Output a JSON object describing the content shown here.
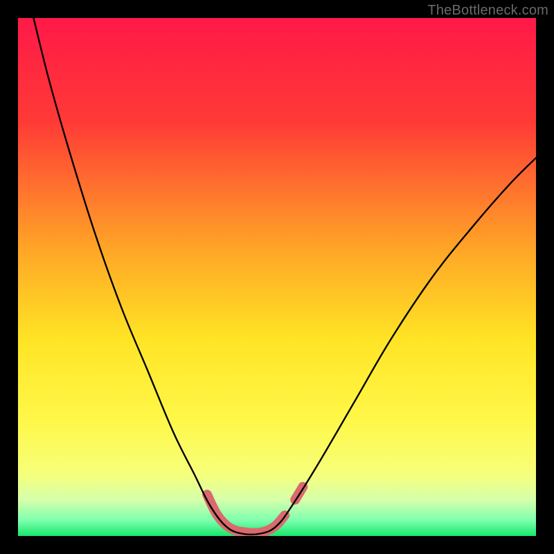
{
  "watermark": "TheBottleneck.com",
  "chart_data": {
    "type": "line",
    "title": "",
    "xlabel": "",
    "ylabel": "",
    "xlim": [
      0,
      100
    ],
    "ylim": [
      0,
      100
    ],
    "gradient_stops": [
      {
        "offset": 0,
        "color": "#ff1948"
      },
      {
        "offset": 20,
        "color": "#ff3a36"
      },
      {
        "offset": 45,
        "color": "#ffa726"
      },
      {
        "offset": 62,
        "color": "#ffe425"
      },
      {
        "offset": 78,
        "color": "#fff84a"
      },
      {
        "offset": 88,
        "color": "#f6ff7a"
      },
      {
        "offset": 93,
        "color": "#d6ffab"
      },
      {
        "offset": 97,
        "color": "#7dffad"
      },
      {
        "offset": 100,
        "color": "#16e76b"
      }
    ],
    "series": [
      {
        "name": "bottleneck-curve",
        "stroke": "#000000",
        "stroke_width": 2.4,
        "points": [
          {
            "x": 3,
            "y": 100
          },
          {
            "x": 6,
            "y": 88
          },
          {
            "x": 10,
            "y": 74
          },
          {
            "x": 15,
            "y": 58
          },
          {
            "x": 20,
            "y": 44
          },
          {
            "x": 25,
            "y": 32
          },
          {
            "x": 30,
            "y": 20
          },
          {
            "x": 34,
            "y": 12
          },
          {
            "x": 37,
            "y": 6
          },
          {
            "x": 40,
            "y": 2
          },
          {
            "x": 43,
            "y": 0.5
          },
          {
            "x": 47,
            "y": 0.5
          },
          {
            "x": 50,
            "y": 2
          },
          {
            "x": 53,
            "y": 6
          },
          {
            "x": 58,
            "y": 14
          },
          {
            "x": 65,
            "y": 26
          },
          {
            "x": 72,
            "y": 38
          },
          {
            "x": 80,
            "y": 50
          },
          {
            "x": 88,
            "y": 60
          },
          {
            "x": 95,
            "y": 68
          },
          {
            "x": 100,
            "y": 73
          }
        ]
      },
      {
        "name": "bottleneck-highlight",
        "stroke": "#d96a6d",
        "stroke_width": 14,
        "points": [
          {
            "x": 36.5,
            "y": 8
          },
          {
            "x": 38.5,
            "y": 4
          },
          {
            "x": 41,
            "y": 1.5
          },
          {
            "x": 44,
            "y": 0.7
          },
          {
            "x": 47,
            "y": 0.7
          },
          {
            "x": 49.5,
            "y": 1.8
          },
          {
            "x": 51.5,
            "y": 4
          }
        ]
      },
      {
        "name": "bottleneck-highlight-dot",
        "stroke": "#d96a6d",
        "stroke_width": 14,
        "points": [
          {
            "x": 53.5,
            "y": 7
          },
          {
            "x": 55,
            "y": 9.5
          }
        ]
      }
    ]
  }
}
